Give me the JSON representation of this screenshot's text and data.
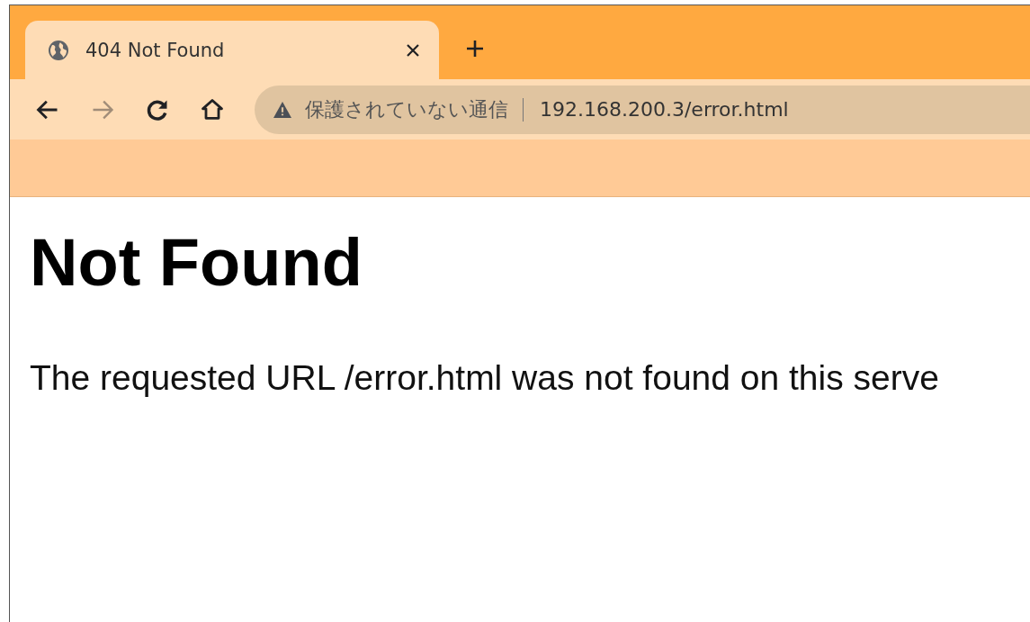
{
  "tabs": [
    {
      "title": "404 Not Found",
      "selected": true
    }
  ],
  "toolbar": {
    "buttons": [
      {
        "kind": "back",
        "disabled": false
      },
      {
        "kind": "forward",
        "disabled": true
      },
      {
        "kind": "reload",
        "disabled": false
      },
      {
        "kind": "home",
        "disabled": false
      }
    ]
  },
  "address_bar": {
    "security_label": "保護されていない通信",
    "url": "192.168.200.3/error.html"
  },
  "page": {
    "heading": "Not Found",
    "message": "The requested URL /error.html was not found on this serve"
  }
}
